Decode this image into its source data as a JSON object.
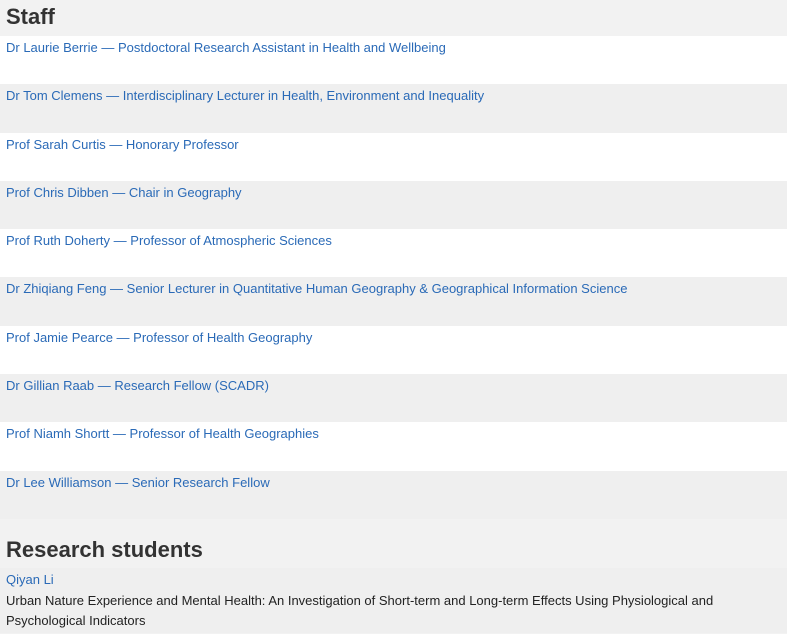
{
  "staff": {
    "heading": "Staff",
    "members": [
      {
        "label": "Dr Laurie Berrie — Postdoctoral Research Assistant in Health and Wellbeing"
      },
      {
        "label": "Dr Tom Clemens — Interdisciplinary Lecturer in Health, Environment and Inequality"
      },
      {
        "label": "Prof Sarah Curtis — Honorary Professor"
      },
      {
        "label": "Prof Chris Dibben — Chair in Geography"
      },
      {
        "label": "Prof Ruth Doherty — Professor of Atmospheric Sciences"
      },
      {
        "label": "Dr Zhiqiang Feng — Senior Lecturer in Quantitative Human Geography & Geographical Information Science"
      },
      {
        "label": "Prof Jamie Pearce — Professor of Health Geography"
      },
      {
        "label": "Dr Gillian Raab — Research Fellow (SCADR)"
      },
      {
        "label": "Prof Niamh Shortt — Professor of Health Geographies"
      },
      {
        "label": "Dr Lee Williamson — Senior Research Fellow"
      }
    ]
  },
  "research_students": {
    "heading": "Research students",
    "students": [
      {
        "name": "Qiyan Li",
        "project": "Urban Nature Experience and Mental Health: An Investigation of Short-term and Long-term Effects Using Physiological and Psychological Indicators"
      }
    ]
  },
  "colors": {
    "link": "#2a6ab7",
    "heading": "#333333",
    "row_alt": "#efefef",
    "row_white": "#ffffff"
  }
}
